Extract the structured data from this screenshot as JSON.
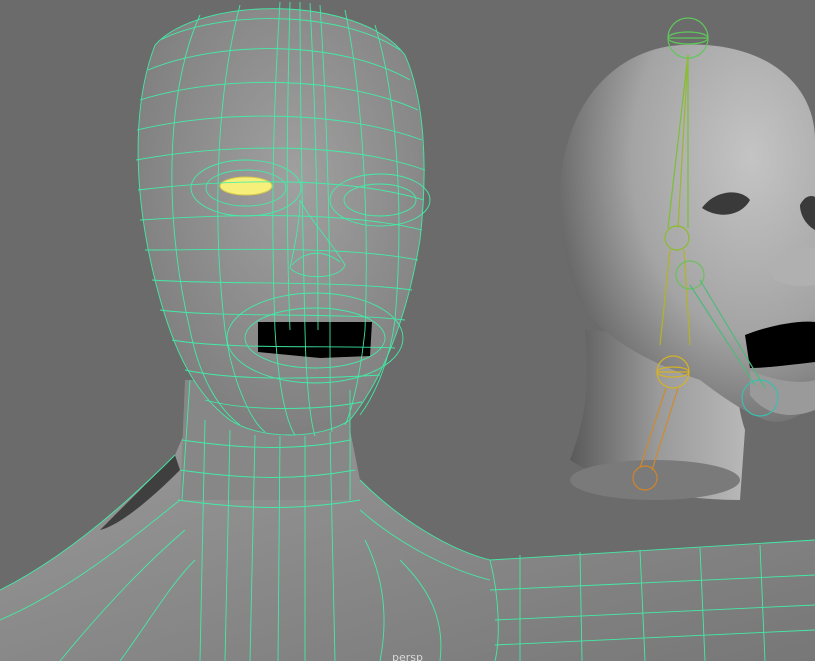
{
  "viewport": {
    "camera_label": "persp",
    "background_color": "#6b6b6b",
    "wireframe_color": "#40f0a8",
    "mesh_color": "#8c8c8c",
    "selection_color": "#f6f07a"
  },
  "objects": {
    "wire_head": {
      "name": "head-mesh-wireframe",
      "display": "wireframe-on-shaded"
    },
    "rigged_head": {
      "name": "head-mesh-shaded-with-joints",
      "display": "smooth-shaded"
    },
    "joints": [
      "head-joint",
      "jaw-joint",
      "neck-joint",
      "neck-base-joint"
    ]
  }
}
